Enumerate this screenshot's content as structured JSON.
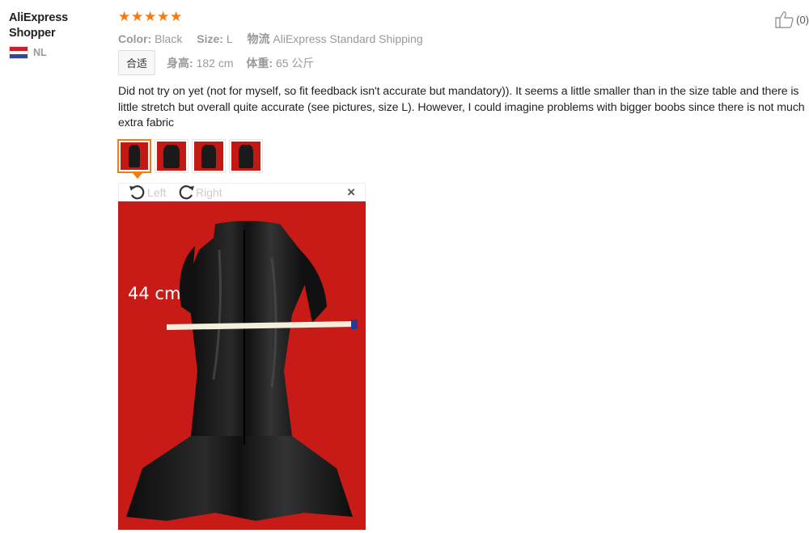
{
  "user": {
    "name": "AliExpress Shopper",
    "country_code": "NL"
  },
  "rating": {
    "stars": 5
  },
  "likes": {
    "count": "(0)"
  },
  "attributes": [
    {
      "key": "Color:",
      "value": "Black"
    },
    {
      "key": "Size:",
      "value": "L"
    },
    {
      "key": "物流",
      "value": "AliExpress Standard Shipping"
    }
  ],
  "fit": {
    "tag": "合适",
    "height_label": "身高:",
    "height_value": "182 cm",
    "weight_label": "体重:",
    "weight_value": "65 公斤"
  },
  "review": {
    "text": "Did not try on yet (not for myself, so fit feedback isn't accurate but mandatory)). It seems a little smaller than in the size table and there is little stretch but overall quite accurate (see pictures, size L). However, I could imagine problems with bigger boobs since there is not much extra fabric"
  },
  "viewer": {
    "rotate_left": "Left",
    "rotate_right": "Right",
    "close": "×",
    "photo_label": "44 cm"
  },
  "colors": {
    "accent": "#f47b0f",
    "photo_bg": "#c81b18"
  },
  "thumbnails_count": 4
}
